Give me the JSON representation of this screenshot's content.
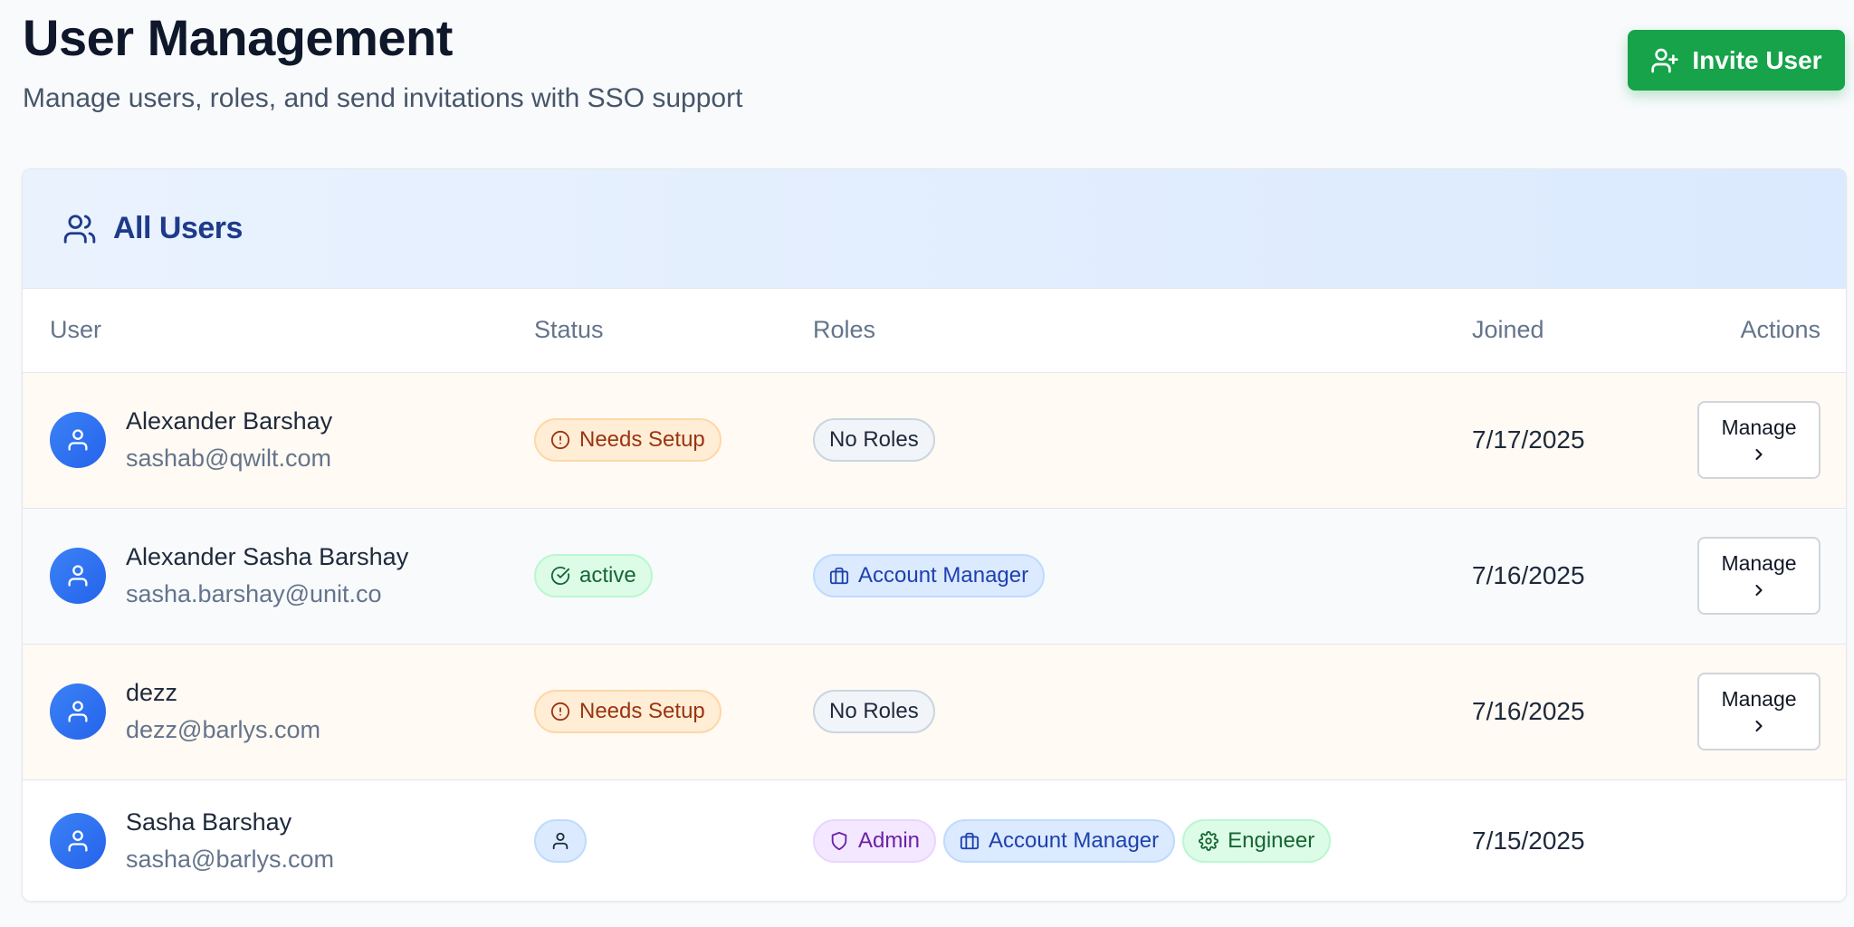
{
  "header": {
    "title": "User Management",
    "subtitle": "Manage users, roles, and send invitations with SSO support",
    "invite_label": "Invite User"
  },
  "card": {
    "title": "All Users"
  },
  "table": {
    "columns": [
      "User",
      "Status",
      "Roles",
      "Joined",
      "Actions"
    ],
    "rows": [
      {
        "name": "Alexander Barshay",
        "email": "sashab@qwilt.com",
        "status": "Needs Setup",
        "role_0": "No Roles",
        "joined": "7/17/2025",
        "action": "Manage"
      },
      {
        "name": "Alexander Sasha Barshay",
        "email": "sasha.barshay@unit.co",
        "status": "active",
        "role_0": "Account Manager",
        "joined": "7/16/2025",
        "action": "Manage"
      },
      {
        "name": "dezz",
        "email": "dezz@barlys.com",
        "status": "Needs Setup",
        "role_0": "No Roles",
        "joined": "7/16/2025",
        "action": "Manage"
      },
      {
        "name": "Sasha Barshay",
        "email": "sasha@barlys.com",
        "status": "",
        "role_0": "Admin",
        "role_1": "Account Manager",
        "role_2": "Engineer",
        "joined": "7/15/2025"
      }
    ]
  },
  "colors": {
    "primary_green": "#16a34a",
    "avatar_blue": "#2563eb",
    "header_navy": "#1e3a8a",
    "warning_bg": "#ffedd5",
    "active_bg": "#dcfce7"
  },
  "icons": {
    "invite": "user-plus-icon",
    "card": "users-icon",
    "avatar": "user-icon",
    "needs_setup": "alert-circle-icon",
    "active": "check-circle-icon",
    "account_manager": "briefcase-icon",
    "admin": "shield-icon",
    "engineer": "gear-icon",
    "manage": "chevron-right-icon"
  }
}
